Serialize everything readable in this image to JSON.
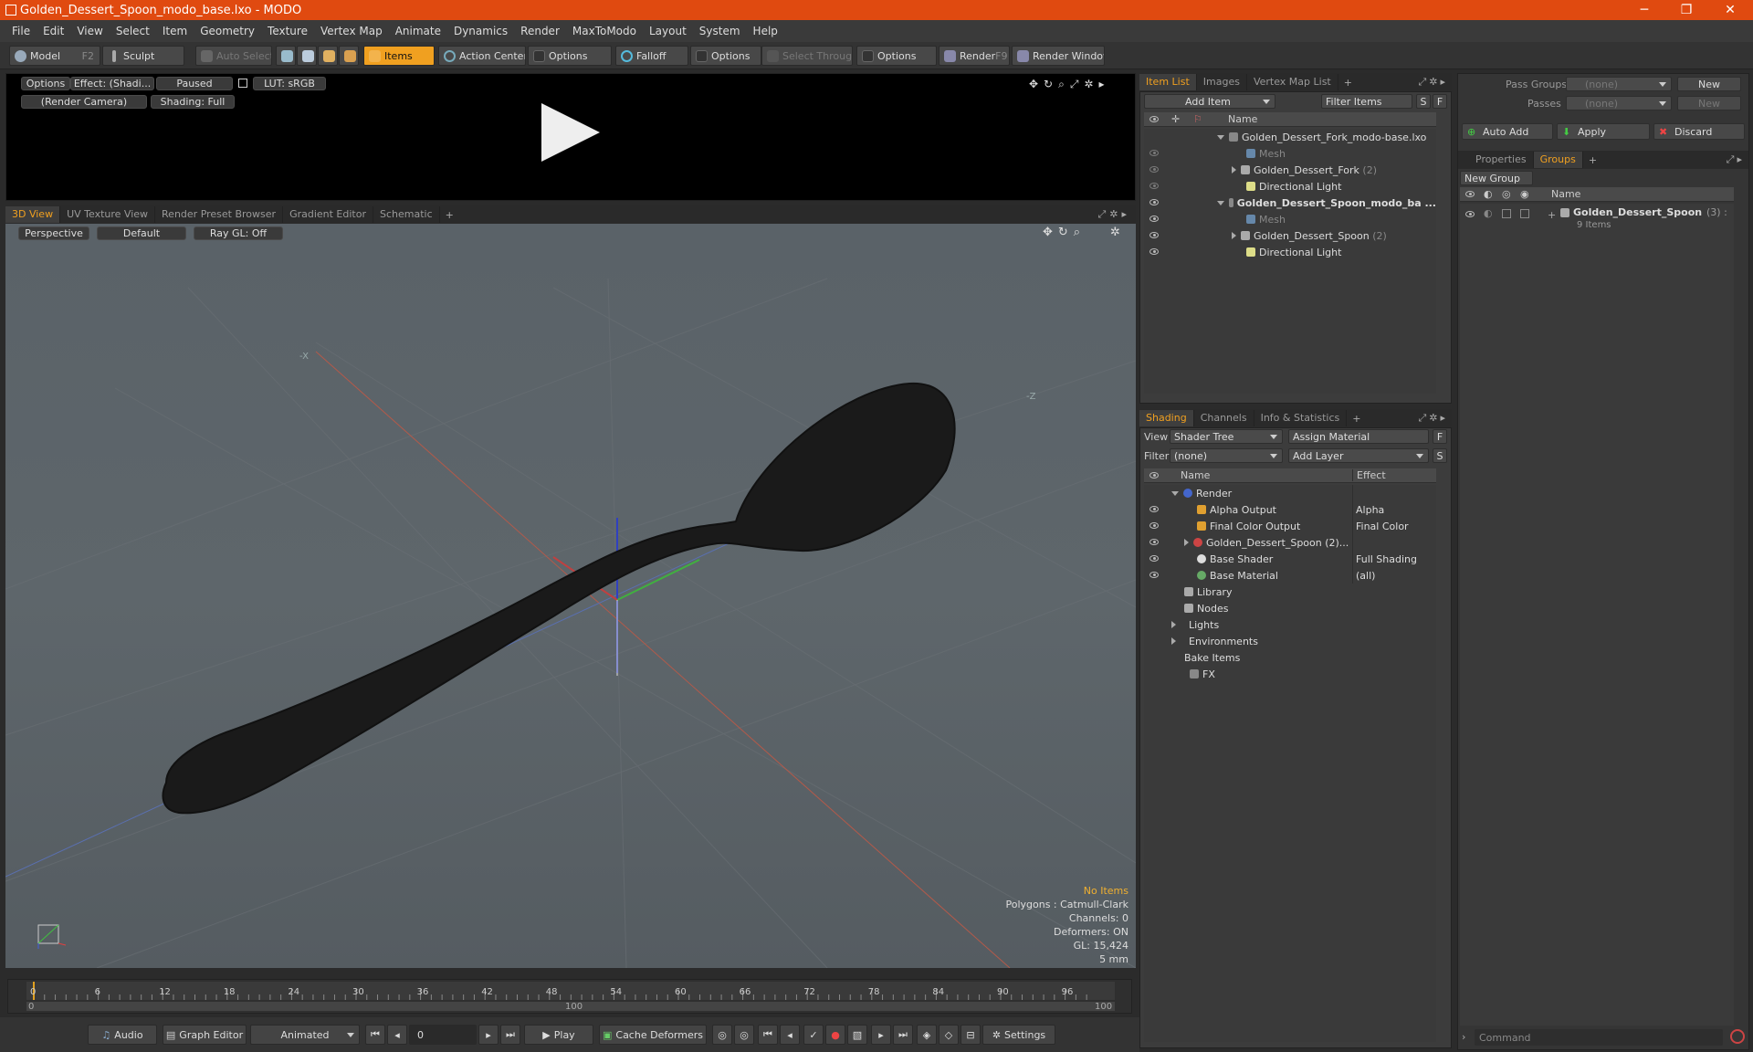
{
  "window": {
    "title": "Golden_Dessert_Spoon_modo_base.lxo - MODO",
    "minimize": "─",
    "restore": "❐",
    "close": "✕"
  },
  "menu": [
    "File",
    "Edit",
    "View",
    "Select",
    "Item",
    "Geometry",
    "Texture",
    "Vertex Map",
    "Animate",
    "Dynamics",
    "Render",
    "MaxToModo",
    "Layout",
    "System",
    "Help"
  ],
  "toolbar": {
    "model": "Model",
    "model_key": "F2",
    "sculpt": "Sculpt",
    "auto_select": "Auto Select",
    "items": "Items",
    "action_center": "Action Center",
    "options1": "Options",
    "falloff": "Falloff",
    "options2": "Options",
    "select_through": "Select Through",
    "options3": "Options",
    "render": "Render",
    "render_key": "F9",
    "render_window": "Render Window"
  },
  "preview": {
    "options": "Options",
    "effect": "Effect: (Shadi...",
    "paused": "Paused",
    "lut": "LUT: sRGB",
    "camera": "(Render Camera)",
    "shading": "Shading: Full"
  },
  "viewport_tabs": [
    "3D View",
    "UV Texture View",
    "Render Preset Browser",
    "Gradient Editor",
    "Schematic"
  ],
  "viewport": {
    "perspective": "Perspective",
    "default": "Default",
    "raygl": "Ray GL: Off",
    "axis_neg_x": "-X",
    "axis_neg_z": "-Z",
    "stats": {
      "no_items": "No Items",
      "polygons": "Polygons : Catmull-Clark",
      "channels": "Channels: 0",
      "deformers": "Deformers: ON",
      "gl": "GL: 15,424",
      "units": "5 mm"
    }
  },
  "item_list": {
    "tabs": [
      "Item List",
      "Images",
      "Vertex Map List"
    ],
    "add_item": "Add Item",
    "filter_items": "Filter Items",
    "s": "S",
    "f": "F",
    "col_name": "Name",
    "rows": [
      {
        "label": "Golden_Dessert_Fork_modo-base.lxo",
        "count": ""
      },
      {
        "label": "Mesh",
        "count": ""
      },
      {
        "label": "Golden_Dessert_Fork",
        "count": "(2)"
      },
      {
        "label": "Directional Light",
        "count": ""
      },
      {
        "label": "Golden_Dessert_Spoon_modo_ba ...",
        "count": ""
      },
      {
        "label": "Mesh",
        "count": ""
      },
      {
        "label": "Golden_Dessert_Spoon",
        "count": "(2)"
      },
      {
        "label": "Directional Light",
        "count": ""
      }
    ]
  },
  "shading": {
    "tabs": [
      "Shading",
      "Channels",
      "Info & Statistics"
    ],
    "view_label": "View",
    "view_value": "Shader Tree",
    "assign_material": "Assign Material",
    "f": "F",
    "filter_label": "Filter",
    "filter_value": "(none)",
    "add_layer": "Add Layer",
    "s": "S",
    "col_name": "Name",
    "col_effect": "Effect",
    "rows": [
      {
        "name": "Render",
        "effect": ""
      },
      {
        "name": "Alpha Output",
        "effect": "Alpha"
      },
      {
        "name": "Final Color Output",
        "effect": "Final Color"
      },
      {
        "name": "Golden_Dessert_Spoon (2)...",
        "effect": ""
      },
      {
        "name": "Base Shader",
        "effect": "Full Shading"
      },
      {
        "name": "Base Material",
        "effect": "(all)"
      },
      {
        "name": "Library",
        "effect": ""
      },
      {
        "name": "Nodes",
        "effect": ""
      },
      {
        "name": "Lights",
        "effect": ""
      },
      {
        "name": "Environments",
        "effect": ""
      },
      {
        "name": "Bake Items",
        "effect": ""
      },
      {
        "name": "FX",
        "effect": ""
      }
    ]
  },
  "groups": {
    "pass_groups_label": "Pass Groups",
    "pass_groups_value": "(none)",
    "new": "New",
    "passes_label": "Passes",
    "passes_value": "(none)",
    "new2": "New",
    "auto_add": "Auto Add",
    "apply": "Apply",
    "discard": "Discard",
    "tabs": [
      "Properties",
      "Groups"
    ],
    "new_group": "New Group",
    "col_name": "Name",
    "item_name": "Golden_Dessert_Spoon",
    "item_count": "(3) :",
    "item_sub": "9 Items"
  },
  "timeline": {
    "ticks": [
      "0",
      "6",
      "12",
      "18",
      "24",
      "30",
      "36",
      "42",
      "48",
      "54",
      "60",
      "66",
      "72",
      "78",
      "84",
      "90",
      "96"
    ],
    "range_start": "0",
    "range_mid": "100",
    "range_end": "100"
  },
  "bottom": {
    "audio": "Audio",
    "graph_editor": "Graph Editor",
    "animated": "Animated",
    "frame": "0",
    "play": "Play",
    "cache_deformers": "Cache Deformers",
    "settings": "Settings",
    "command": "Command"
  }
}
